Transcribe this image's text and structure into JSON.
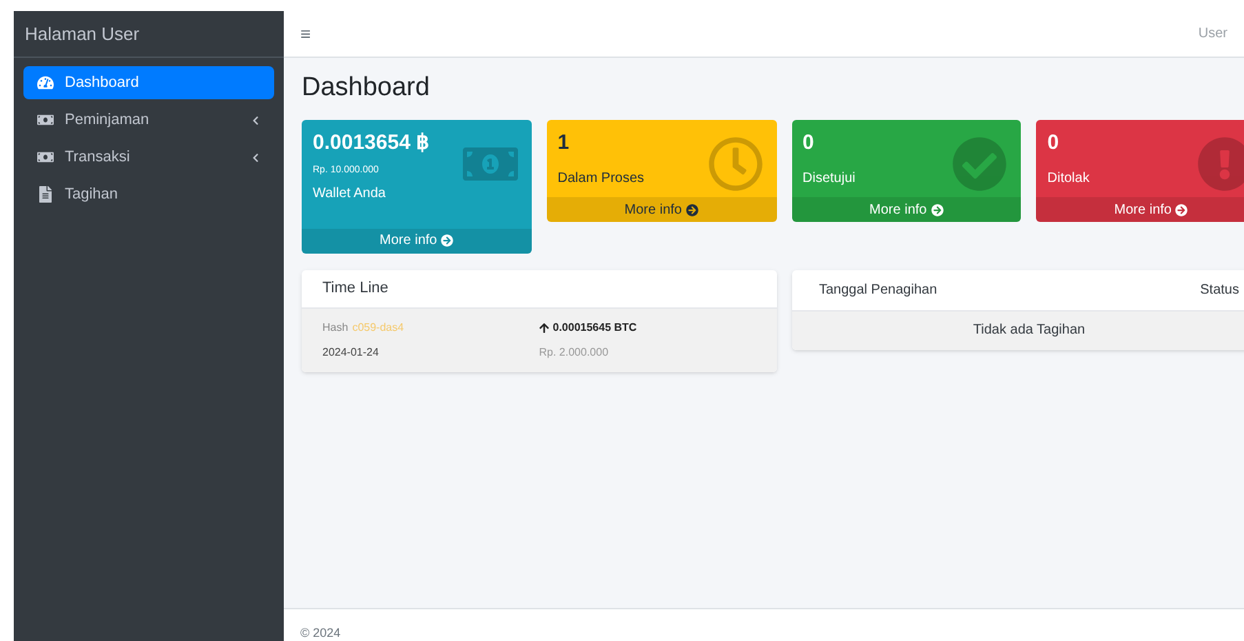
{
  "sidebar": {
    "brand": "Halaman User",
    "items": [
      {
        "label": "Dashboard",
        "kind": "gauge",
        "selected": true,
        "has_submenu": false
      },
      {
        "label": "Peminjaman",
        "kind": "money",
        "selected": false,
        "has_submenu": true
      },
      {
        "label": "Transaksi",
        "kind": "money",
        "selected": false,
        "has_submenu": true
      },
      {
        "label": "Tagihan",
        "kind": "file",
        "selected": false,
        "has_submenu": false
      }
    ]
  },
  "navbar": {
    "menu_glyph": "≡",
    "user": "User"
  },
  "page_title": "Dashboard",
  "cards": [
    {
      "kind": "wallet",
      "value": "0.0013654",
      "currency": "฿",
      "subtext": "Rp. 10.000.000",
      "label": "Wallet Anda",
      "link": "More info",
      "color": "#17a2b8"
    },
    {
      "kind": "pending",
      "value": "1",
      "label": "Dalam Proses",
      "link": "More info",
      "color": "#ffc107"
    },
    {
      "kind": "approved",
      "value": "0",
      "label": "Disetujui",
      "link": "More info",
      "color": "#28a745"
    },
    {
      "kind": "rejected",
      "value": "0",
      "label": "Ditolak",
      "link": "More info",
      "color": "#dc3545"
    }
  ],
  "timeline": {
    "title": "Time Line",
    "entries": [
      {
        "hash_label": "Hash",
        "hash": "c059-das4",
        "date": "2024-01-24",
        "amount": "0.00015645 BTC",
        "rupiah": "Rp. 2.000.000"
      }
    ]
  },
  "billing": {
    "columns": [
      "Tanggal Penagihan",
      "Status"
    ],
    "empty": "Tidak ada Tagihan"
  },
  "footer": "© 2024"
}
